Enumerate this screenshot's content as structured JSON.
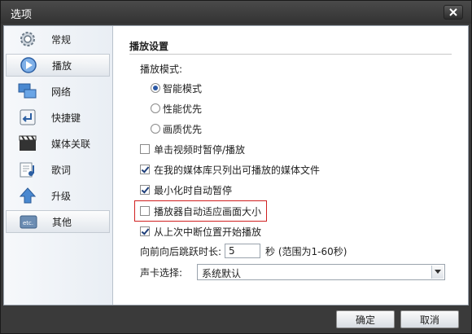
{
  "window": {
    "title": "选项"
  },
  "sidebar": {
    "items": [
      {
        "label": "常规",
        "icon": "gear-icon"
      },
      {
        "label": "播放",
        "icon": "play-icon",
        "selected": true
      },
      {
        "label": "网络",
        "icon": "network-icon"
      },
      {
        "label": "快捷键",
        "icon": "keyboard-icon"
      },
      {
        "label": "媒体关联",
        "icon": "clapperboard-icon"
      },
      {
        "label": "歌词",
        "icon": "lyrics-icon"
      },
      {
        "label": "升级",
        "icon": "upgrade-arrow-icon"
      },
      {
        "label": "其他",
        "icon": "etc-icon"
      }
    ]
  },
  "panel": {
    "section_title": "播放设置",
    "mode_label": "播放模式:",
    "modes": [
      {
        "label": "智能模式",
        "selected": true
      },
      {
        "label": "性能优先",
        "selected": false
      },
      {
        "label": "画质优先",
        "selected": false
      }
    ],
    "checks": [
      {
        "label": "单击视频时暂停/播放",
        "checked": false
      },
      {
        "label": "在我的媒体库只列出可播放的媒体文件",
        "checked": true
      },
      {
        "label": "最小化时自动暂停",
        "checked": true
      },
      {
        "label": "播放器自动适应画面大小",
        "checked": false
      },
      {
        "label": "从上次中断位置开始播放",
        "checked": true
      }
    ],
    "seek": {
      "label": "向前向后跳跃时长:",
      "value": "5",
      "unit": "秒 (范围为1-60秒)"
    },
    "soundcard": {
      "label": "声卡选择:",
      "value": "系统默认"
    }
  },
  "footer": {
    "ok_label": "确定",
    "cancel_label": "取消"
  },
  "colors": {
    "accent": "#2a58a5",
    "highlight": "#d02020"
  }
}
